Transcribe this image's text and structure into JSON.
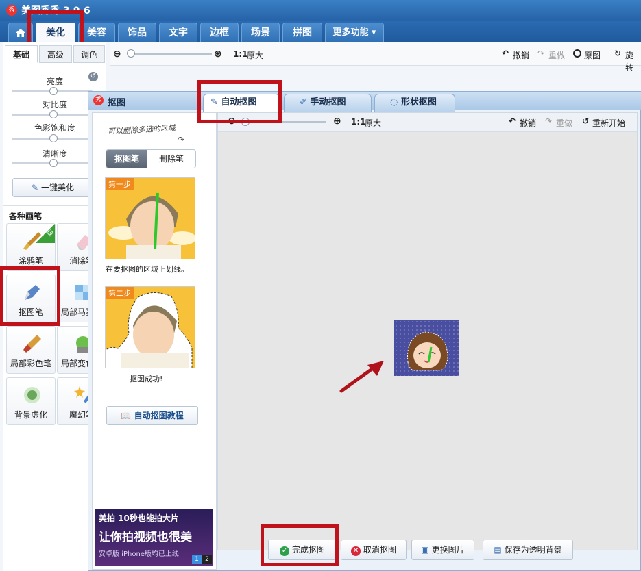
{
  "app": {
    "title": "美图秀秀 3.9.6",
    "logo_glyph": "秀"
  },
  "nav": {
    "tabs": [
      "美化",
      "美容",
      "饰品",
      "文字",
      "边框",
      "场景",
      "拼图"
    ],
    "more": "更多功能 ▾"
  },
  "left": {
    "subtabs": [
      "基础",
      "高级",
      "调色"
    ],
    "sliders": [
      {
        "label": "亮度",
        "value": 0.5
      },
      {
        "label": "对比度",
        "value": 0.5
      },
      {
        "label": "色彩饱和度",
        "value": 0.5
      },
      {
        "label": "清晰度",
        "value": 0.5
      }
    ],
    "one_click": "一键美化",
    "brushes_title": "各种画笔",
    "brushes": [
      "涂鸦笔",
      "消除笔",
      "抠图笔",
      "局部马赛克",
      "局部彩色笔",
      "局部变色笔",
      "背景虚化",
      "魔幻笔"
    ],
    "upgrade_badge": "升级"
  },
  "toolbar": {
    "zoom_ratio": "1:1",
    "original_size": "原大",
    "undo": "撤销",
    "redo": "重做",
    "original_image": "原图",
    "rotate": "旋转"
  },
  "dialog": {
    "title": "抠图",
    "tabs": [
      "自动抠图",
      "手动抠图",
      "形状抠图"
    ],
    "hint_handwritten": "可以删除多选的区域",
    "pen_toggle": [
      "抠图笔",
      "删除笔"
    ],
    "step1": {
      "tag": "第一步",
      "caption": "在要抠图的区域上划线。"
    },
    "step2": {
      "tag": "第二步",
      "caption": "抠图成功!"
    },
    "tutorial": "自动抠图教程",
    "ad": {
      "line1": "美拍 10秒也能拍大片",
      "line2": "让你拍视频也很美",
      "line3": "安卓版 iPhone版均已上线",
      "pages": [
        "1",
        "2"
      ]
    },
    "canvas_toolbar": {
      "zoom_ratio": "1:1",
      "original_size": "原大",
      "undo": "撤销",
      "redo": "重做",
      "restart": "重新开始"
    },
    "buttons": {
      "finish": "完成抠图",
      "cancel": "取消抠图",
      "change": "更换图片",
      "save": "保存为透明背景"
    }
  },
  "colors": {
    "accent": "#2663a8",
    "highlight_box": "#c0121b",
    "arrow": "#b0121b"
  }
}
